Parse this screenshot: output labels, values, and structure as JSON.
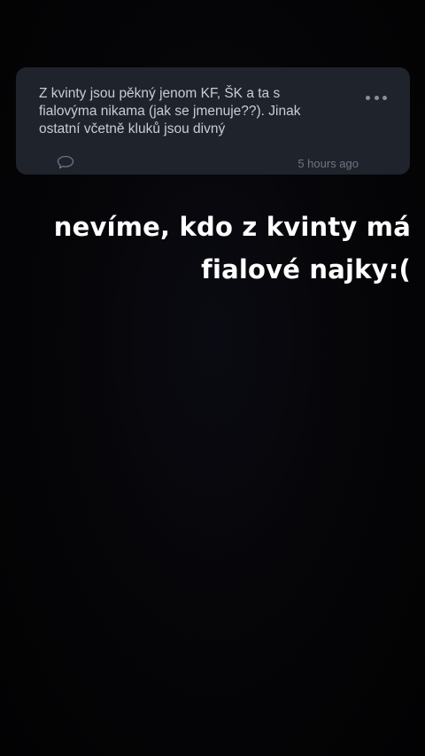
{
  "comment": {
    "text": "Z kvinty jsou pěkný jenom KF, ŠK a ta s\nfialovýma  nikama (jak se jmenuje??). Jinak\nostatní včetně kluků jsou divný",
    "timestamp": "5 hours ago",
    "icons": {
      "reply": "speech-bubble-icon",
      "more": "more-dots-icon"
    }
  },
  "caption": {
    "line1": "nevíme, kdo z kvinty má",
    "line2": "fialové najky:("
  },
  "colors": {
    "background": "#050507",
    "card": "#1f232b",
    "comment_text": "#c9ccd3",
    "muted": "#6f7580",
    "caption": "#ffffff"
  }
}
